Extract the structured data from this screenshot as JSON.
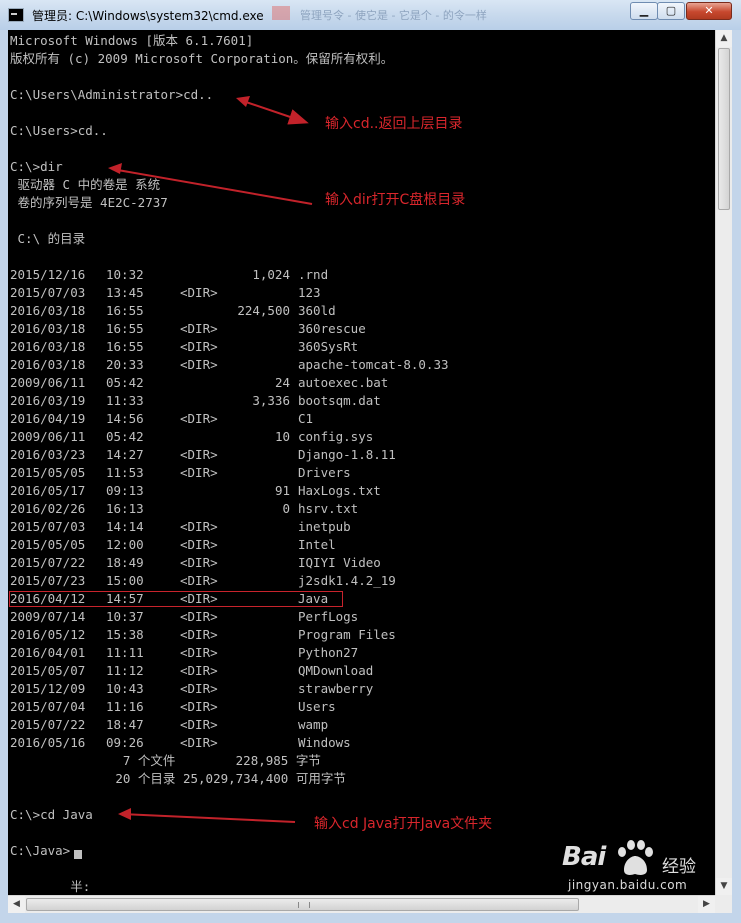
{
  "window": {
    "title": "管理员: C:\\Windows\\system32\\cmd.exe",
    "background_title_ghost": "管理号令 - 使它是 - 它是个 - 的令一样",
    "minimize_glyph": "▁",
    "maximize_glyph": "▢",
    "close_glyph": "✕"
  },
  "console": {
    "text_color": "#c0c0c0",
    "background": "#000000",
    "lines": [
      "Microsoft Windows [版本 6.1.7601]",
      "版权所有 (c) 2009 Microsoft Corporation。保留所有权利。",
      "C:\\Users\\Administrator>cd..",
      "C:\\Users>cd..",
      "C:\\>dir",
      " 驱动器 C 中的卷是 系统",
      " 卷的序列号是 4E2C-2737",
      " C:\\ 的目录"
    ],
    "listing": [
      {
        "date": "2015/12/16",
        "time": "10:32",
        "tag": "",
        "size": "1,024",
        "name": ".rnd"
      },
      {
        "date": "2015/07/03",
        "time": "13:45",
        "tag": "<DIR>",
        "size": "",
        "name": "123"
      },
      {
        "date": "2016/03/18",
        "time": "16:55",
        "tag": "",
        "size": "224,500",
        "name": "360ld"
      },
      {
        "date": "2016/03/18",
        "time": "16:55",
        "tag": "<DIR>",
        "size": "",
        "name": "360rescue"
      },
      {
        "date": "2016/03/18",
        "time": "16:55",
        "tag": "<DIR>",
        "size": "",
        "name": "360SysRt"
      },
      {
        "date": "2016/03/18",
        "time": "20:33",
        "tag": "<DIR>",
        "size": "",
        "name": "apache-tomcat-8.0.33"
      },
      {
        "date": "2009/06/11",
        "time": "05:42",
        "tag": "",
        "size": "24",
        "name": "autoexec.bat"
      },
      {
        "date": "2016/03/19",
        "time": "11:33",
        "tag": "",
        "size": "3,336",
        "name": "bootsqm.dat"
      },
      {
        "date": "2016/04/19",
        "time": "14:56",
        "tag": "<DIR>",
        "size": "",
        "name": "C1"
      },
      {
        "date": "2009/06/11",
        "time": "05:42",
        "tag": "",
        "size": "10",
        "name": "config.sys"
      },
      {
        "date": "2016/03/23",
        "time": "14:27",
        "tag": "<DIR>",
        "size": "",
        "name": "Django-1.8.11"
      },
      {
        "date": "2015/05/05",
        "time": "11:53",
        "tag": "<DIR>",
        "size": "",
        "name": "Drivers"
      },
      {
        "date": "2016/05/17",
        "time": "09:13",
        "tag": "",
        "size": "91",
        "name": "HaxLogs.txt"
      },
      {
        "date": "2016/02/26",
        "time": "16:13",
        "tag": "",
        "size": "0",
        "name": "hsrv.txt"
      },
      {
        "date": "2015/07/03",
        "time": "14:14",
        "tag": "<DIR>",
        "size": "",
        "name": "inetpub"
      },
      {
        "date": "2015/05/05",
        "time": "12:00",
        "tag": "<DIR>",
        "size": "",
        "name": "Intel"
      },
      {
        "date": "2015/07/22",
        "time": "18:49",
        "tag": "<DIR>",
        "size": "",
        "name": "IQIYI Video"
      },
      {
        "date": "2015/07/23",
        "time": "15:00",
        "tag": "<DIR>",
        "size": "",
        "name": "j2sdk1.4.2_19"
      },
      {
        "date": "2016/04/12",
        "time": "14:57",
        "tag": "<DIR>",
        "size": "",
        "name": "Java"
      },
      {
        "date": "2009/07/14",
        "time": "10:37",
        "tag": "<DIR>",
        "size": "",
        "name": "PerfLogs"
      },
      {
        "date": "2016/05/12",
        "time": "15:38",
        "tag": "<DIR>",
        "size": "",
        "name": "Program Files"
      },
      {
        "date": "2016/04/01",
        "time": "11:11",
        "tag": "<DIR>",
        "size": "",
        "name": "Python27"
      },
      {
        "date": "2015/05/07",
        "time": "11:12",
        "tag": "<DIR>",
        "size": "",
        "name": "QMDownload"
      },
      {
        "date": "2015/12/09",
        "time": "10:43",
        "tag": "<DIR>",
        "size": "",
        "name": "strawberry"
      },
      {
        "date": "2015/07/04",
        "time": "11:16",
        "tag": "<DIR>",
        "size": "",
        "name": "Users"
      },
      {
        "date": "2015/07/22",
        "time": "18:47",
        "tag": "<DIR>",
        "size": "",
        "name": "wamp"
      },
      {
        "date": "2016/05/16",
        "time": "09:26",
        "tag": "<DIR>",
        "size": "",
        "name": "Windows"
      }
    ],
    "summary": {
      "files": "               7 个文件        228,985 字节",
      "dirs": "              20 个目录 25,029,734,400 可用字节"
    },
    "cd_java": "C:\\>cd Java",
    "java_prompt": "C:\\Java>",
    "ime_status": "        半:"
  },
  "annotations": {
    "color": "#d8262c",
    "cd_up": "输入cd..返回上层目录",
    "dir": "输入dir打开C盘根目录",
    "cd_java": "输入cd Java打开Java文件夹"
  },
  "watermark": {
    "brand": "Bai",
    "brand_tail": "du",
    "cn": "经验",
    "url": "jingyan.baidu.com"
  },
  "scrollbar": {
    "up_glyph": "▲",
    "down_glyph": "▼",
    "left_glyph": "◀",
    "right_glyph": "▶"
  }
}
